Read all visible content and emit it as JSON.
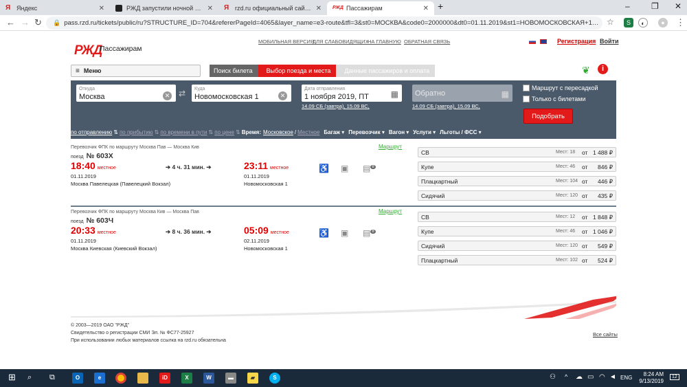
{
  "browser": {
    "tabs": [
      {
        "label": "Яндекс",
        "icon": "yandex-icon",
        "color": "#e21a1a"
      },
      {
        "label": "РЖД запустили ночной поезд и",
        "icon": "news-icon",
        "color": "#222222"
      },
      {
        "label": "rzd.ru официальный сайт — Янд",
        "icon": "yandex-icon",
        "color": "#e21a1a"
      },
      {
        "label": "Пассажирам",
        "icon": "rzd-icon",
        "color": "#e21a1a"
      }
    ],
    "new_tab": "+",
    "window_min": "–",
    "window_max": "❐",
    "window_close": "✕",
    "url": "pass.rzd.ru/tickets/public/ru?STRUCTURE_ID=704&refererPageId=4065&layer_name=e3-route&tfl=3&st0=МОСКВА&code0=2000000&dt0=01.11.2019&st1=НОВОМОСКОВСКАЯ+1&code1=..."
  },
  "header": {
    "logo": "РЖД",
    "site_title": "Пассажирам",
    "links": [
      "МОБИЛЬНАЯ ВЕРСИЯ",
      "ДЛЯ СЛАБОВИДЯЩИХ",
      "НА ГЛАВНУЮ",
      "ОБРАТНАЯ СВЯЗЬ"
    ],
    "register": "Регистрация",
    "login": "Войти",
    "menu": "Меню",
    "steps": [
      "Поиск билета",
      "Выбор поезда и места",
      "Данные пассажиров и оплата"
    ],
    "info_icon": "i"
  },
  "search": {
    "from_label": "Откуда",
    "from_value": "Москва",
    "to_label": "Куда",
    "to_value": "Новомосковская 1",
    "date_label": "Дата отправления",
    "date_value": "1 ноября 2019, ПТ",
    "date_hint": "14.09 СБ (завтра), 15.09 ВС,",
    "return_placeholder": "Обратно",
    "return_hint": "14.09 СБ (завтра), 15.09 ВС,",
    "opt_transfer": "Маршрут с пересадкой",
    "opt_tickets": "Только с билетами",
    "submit": "Подобрать",
    "sort": {
      "by_departure": "по отправлению",
      "by_arrival": "по прибытию",
      "by_travel_time": "по времени в пути",
      "by_price": "по цене",
      "time_label": "Время:",
      "time_moscow": "Московское",
      "time_local": "Местное",
      "filters": [
        "Багаж",
        "Перевозчик",
        "Вагон",
        "Услуги",
        "Льготы / ФСС"
      ]
    }
  },
  "trains": [
    {
      "carrier": "Перевозчик  ФПК    по маршруту Москва Пав — Москва Кив",
      "route_link": "Маршрут",
      "train_label": "поезд",
      "number": "№ 603Х",
      "dep_time": "18:40",
      "dep_suffix": "местное",
      "duration": "4 ч. 31 мин.",
      "arr_time": "23:11",
      "arr_suffix": "местное",
      "dep_date": "01.11.2019",
      "arr_date": "01.11.2019",
      "dep_station": "Москва Павелецкая (Павелецкий Вокзал)",
      "arr_station": "Новомосковская 1",
      "classes": [
        {
          "name": "СВ",
          "seats": "Мест: 18",
          "from": "от",
          "price": "1 488 ₽"
        },
        {
          "name": "Купе",
          "seats": "Мест: 46",
          "from": "от",
          "price": "846 ₽"
        },
        {
          "name": "Плацкартный",
          "seats": "Мест: 104",
          "from": "от",
          "price": "446 ₽"
        },
        {
          "name": "Сидячий",
          "seats": "Мест: 120",
          "from": "от",
          "price": "435 ₽"
        }
      ]
    },
    {
      "carrier": "Перевозчик  ФПК    по маршруту Москва Кив — Москва Пав",
      "route_link": "Маршрут",
      "train_label": "поезд",
      "number": "№ 603Ч",
      "dep_time": "20:33",
      "dep_suffix": "местное",
      "duration": "8 ч. 36 мин.",
      "arr_time": "05:09",
      "arr_suffix": "местное",
      "dep_date": "01.11.2019",
      "arr_date": "02.11.2019",
      "dep_station": "Москва Киевская (Киевский Вокзал)",
      "arr_station": "Новомосковская 1",
      "classes": [
        {
          "name": "СВ",
          "seats": "Мест: 12",
          "from": "от",
          "price": "1 848 ₽"
        },
        {
          "name": "Купе",
          "seats": "Мест: 46",
          "from": "от",
          "price": "1 046 ₽"
        },
        {
          "name": "Сидячий",
          "seats": "Мест: 120",
          "from": "от",
          "price": "549 ₽"
        },
        {
          "name": "Плацкартный",
          "seats": "Мест: 102",
          "from": "от",
          "price": "524 ₽"
        }
      ]
    }
  ],
  "footer": {
    "copyright": "© 2003—2019  ОАО \"РЖД\"",
    "license": "Свидетельство о регистрации СМИ Эл. № ФС77-25927",
    "notice": "При использовании любых материалов ссылка на rzd.ru обязательна",
    "all_sites": "Все сайты"
  },
  "taskbar": {
    "badge_count": "8",
    "lang": "ENG",
    "time": "8:24 AM",
    "date": "9/13/2019",
    "notifications": "12"
  }
}
